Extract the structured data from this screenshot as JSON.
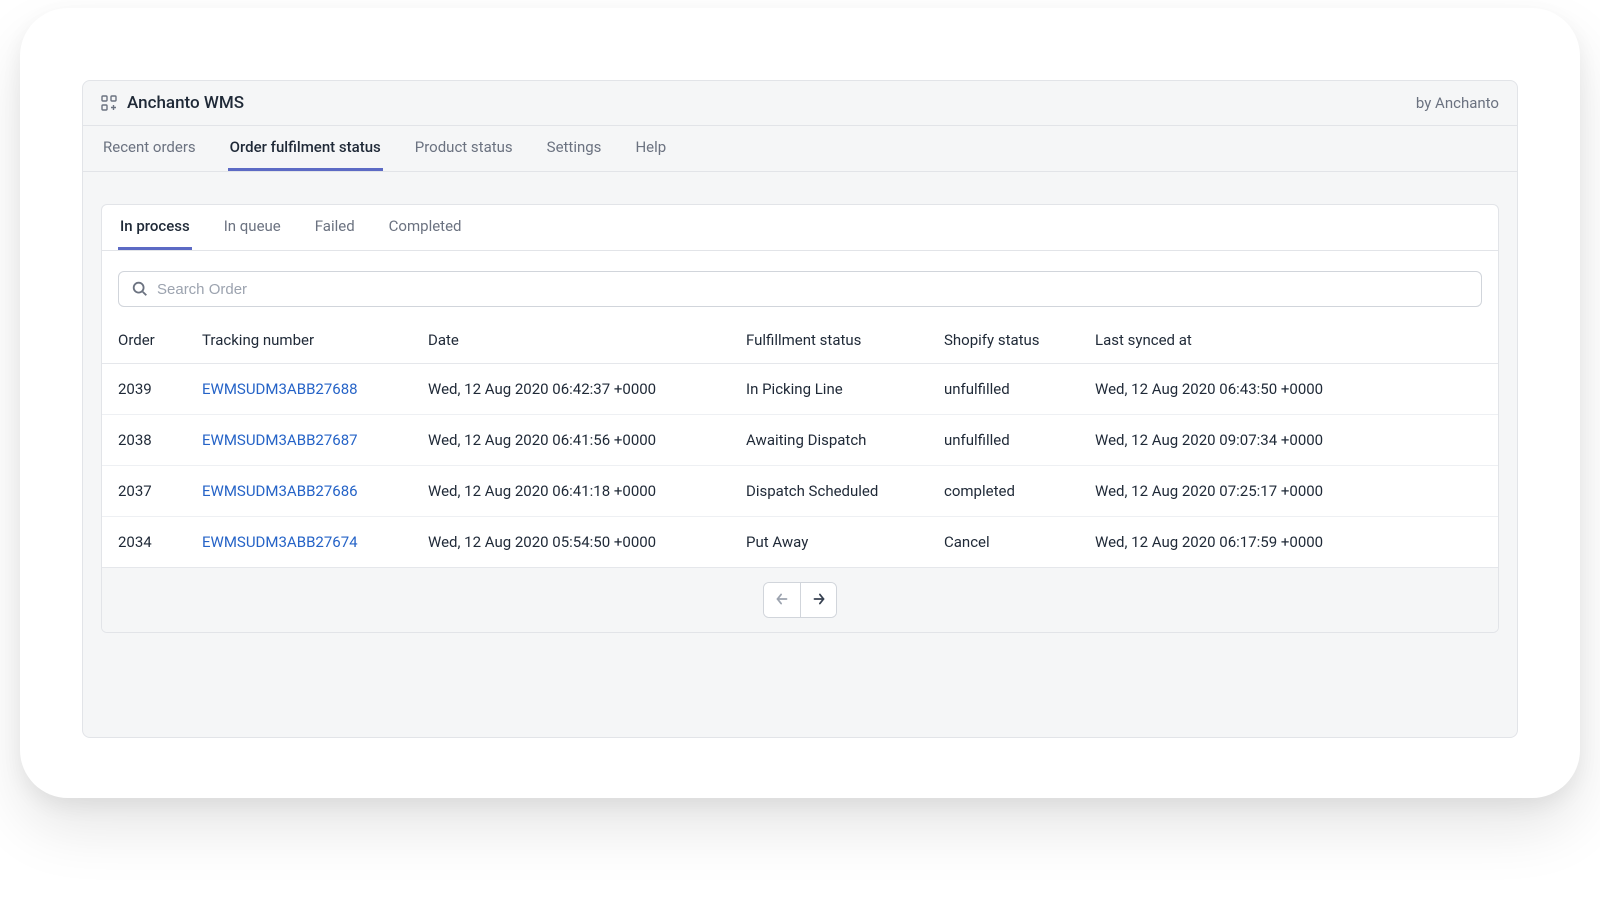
{
  "header": {
    "title": "Anchanto WMS",
    "byline": "by Anchanto"
  },
  "topnav": {
    "items": [
      {
        "label": "Recent orders"
      },
      {
        "label": "Order fulfilment status"
      },
      {
        "label": "Product status"
      },
      {
        "label": "Settings"
      },
      {
        "label": "Help"
      }
    ]
  },
  "subnav": {
    "items": [
      {
        "label": "In process"
      },
      {
        "label": "In queue"
      },
      {
        "label": "Failed"
      },
      {
        "label": "Completed"
      }
    ]
  },
  "search": {
    "placeholder": "Search Order"
  },
  "table": {
    "columns": {
      "order": "Order",
      "tracking": "Tracking number",
      "date": "Date",
      "fulfillment": "Fulfillment status",
      "shopify": "Shopify status",
      "synced": "Last synced at"
    },
    "rows": [
      {
        "order": "2039",
        "tracking": "EWMSUDM3ABB27688",
        "date": "Wed, 12 Aug 2020 06:42:37 +0000",
        "fulfillment": "In Picking Line",
        "shopify": "unfulfilled",
        "synced": "Wed, 12 Aug 2020 06:43:50 +0000"
      },
      {
        "order": "2038",
        "tracking": "EWMSUDM3ABB27687",
        "date": "Wed, 12 Aug 2020 06:41:56 +0000",
        "fulfillment": "Awaiting Dispatch",
        "shopify": "unfulfilled",
        "synced": "Wed, 12 Aug 2020 09:07:34 +0000"
      },
      {
        "order": "2037",
        "tracking": "EWMSUDM3ABB27686",
        "date": "Wed, 12 Aug 2020 06:41:18 +0000",
        "fulfillment": "Dispatch Scheduled",
        "shopify": "completed",
        "synced": "Wed, 12 Aug 2020 07:25:17 +0000"
      },
      {
        "order": "2034",
        "tracking": "EWMSUDM3ABB27674",
        "date": "Wed, 12 Aug 2020 05:54:50 +0000",
        "fulfillment": "Put Away",
        "shopify": "Cancel",
        "synced": "Wed, 12 Aug 2020 06:17:59 +0000"
      }
    ]
  }
}
